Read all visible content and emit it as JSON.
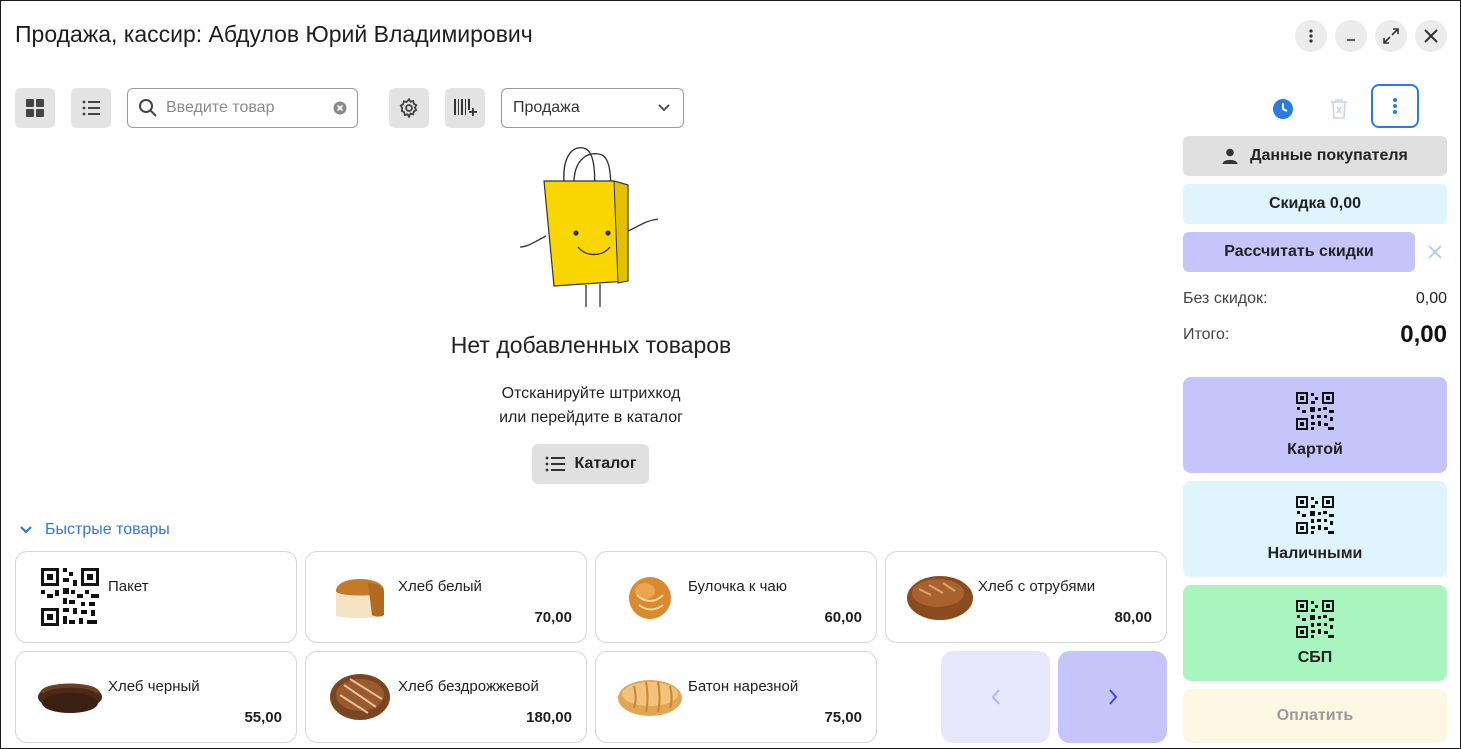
{
  "window": {
    "title": "Продажа, кассир: Абдулов Юрий Владимирович"
  },
  "toolbar": {
    "search_placeholder": "Введите товар",
    "mode_select": "Продажа"
  },
  "empty_state": {
    "title": "Нет добавленных товаров",
    "subtitle_line1": "Отсканируйте штрихкод",
    "subtitle_line2": "или перейдите в каталог",
    "catalog_button": "Каталог"
  },
  "quick_products": {
    "header": "Быстрые товары",
    "items": [
      {
        "name": "Пакет",
        "price": ""
      },
      {
        "name": "Хлеб белый",
        "price": "70,00"
      },
      {
        "name": "Булочка к чаю",
        "price": "60,00"
      },
      {
        "name": "Хлеб с отрубями",
        "price": "80,00"
      },
      {
        "name": "Хлеб черный",
        "price": "55,00"
      },
      {
        "name": "Хлеб бездрожжевой",
        "price": "180,00"
      },
      {
        "name": "Батон нарезной",
        "price": "75,00"
      }
    ]
  },
  "right_panel": {
    "customer_button": "Данные покупателя",
    "discount_button": "Скидка 0,00",
    "calc_discounts_button": "Рассчитать скидки",
    "without_discount_label": "Без скидок:",
    "without_discount_value": "0,00",
    "total_label": "Итого:",
    "total_value": "0,00",
    "pay_card": "Картой",
    "pay_cash": "Наличными",
    "pay_sbp": "СБП",
    "pay_button": "Оплатить"
  },
  "colors": {
    "accent_blue": "#2b7be0",
    "card_purple": "#c5c4fb",
    "cash_light_blue": "#e0f4fd",
    "sbp_green": "#a9f5c0",
    "pay_disabled": "#fdf7e3",
    "bag_yellow": "#f9d600"
  }
}
